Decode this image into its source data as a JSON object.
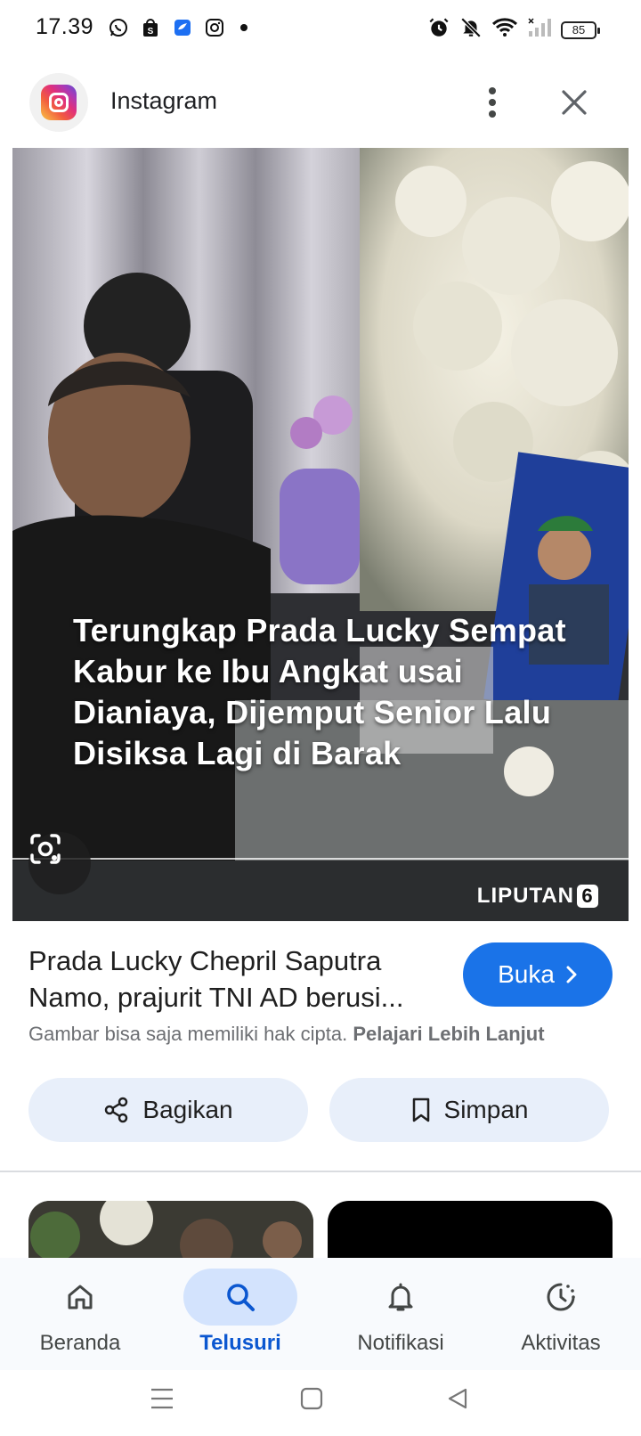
{
  "status_bar": {
    "time": "17.39",
    "battery": "85",
    "left_icons": [
      "whatsapp-icon",
      "shopee-icon",
      "bluesky-icon",
      "instagram-icon"
    ],
    "right_icons": [
      "alarm-icon",
      "mute-icon",
      "wifi-icon",
      "signal-icon"
    ]
  },
  "header": {
    "app_name": "Instagram"
  },
  "image": {
    "caption": "Terungkap Prada Lucky Sempat Kabur ke Ibu Angkat usai Dianiaya, Dijemput Senior Lalu Disiksa Lagi di Barak",
    "watermark_text": "LIPUTAN",
    "watermark_num": "6"
  },
  "result": {
    "title_line1": "Prada Lucky Chepril Saputra",
    "title_line2": "Namo, prajurit TNI AD berusi...",
    "open_label": "Buka",
    "copyright_text": "Gambar bisa saja memiliki hak cipta.",
    "learn_more": "Pelajari Lebih Lanjut"
  },
  "actions": {
    "share_label": "Bagikan",
    "save_label": "Simpan"
  },
  "bottom_nav": {
    "items": [
      {
        "label": "Beranda",
        "icon": "home-icon",
        "active": false
      },
      {
        "label": "Telusuri",
        "icon": "search-icon",
        "active": true
      },
      {
        "label": "Notifikasi",
        "icon": "bell-icon",
        "active": false
      },
      {
        "label": "Aktivitas",
        "icon": "activity-icon",
        "active": false
      }
    ]
  },
  "colors": {
    "accent": "#1a73e8",
    "active_nav": "#0b57d0",
    "pill_bg": "#e8effa"
  }
}
